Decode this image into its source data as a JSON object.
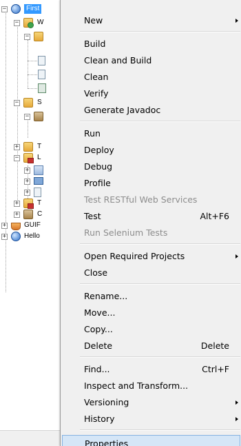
{
  "tree": {
    "selected_project": "First",
    "nodes": [
      {
        "label": "W"
      },
      {
        "label": ""
      },
      {
        "label": "S"
      },
      {
        "label": ""
      },
      {
        "label": "T"
      },
      {
        "label": "L"
      },
      {
        "label": "T"
      },
      {
        "label": "C"
      }
    ],
    "projects": [
      {
        "label": "GUIF"
      },
      {
        "label": "Hello"
      }
    ]
  },
  "context_menu": {
    "groups": [
      [
        {
          "label": "New",
          "submenu": true
        }
      ],
      [
        {
          "label": "Build"
        },
        {
          "label": "Clean and Build"
        },
        {
          "label": "Clean"
        },
        {
          "label": "Verify"
        },
        {
          "label": "Generate Javadoc"
        }
      ],
      [
        {
          "label": "Run"
        },
        {
          "label": "Deploy"
        },
        {
          "label": "Debug"
        },
        {
          "label": "Profile"
        },
        {
          "label": "Test RESTful Web Services",
          "disabled": true
        },
        {
          "label": "Test",
          "shortcut": "Alt+F6"
        },
        {
          "label": "Run Selenium Tests",
          "disabled": true
        }
      ],
      [
        {
          "label": "Open Required Projects",
          "submenu": true
        },
        {
          "label": "Close"
        }
      ],
      [
        {
          "label": "Rename..."
        },
        {
          "label": "Move..."
        },
        {
          "label": "Copy..."
        },
        {
          "label": "Delete",
          "shortcut": "Delete"
        }
      ],
      [
        {
          "label": "Find...",
          "shortcut": "Ctrl+F"
        },
        {
          "label": "Inspect and Transform..."
        },
        {
          "label": "Versioning",
          "submenu": true
        },
        {
          "label": "History",
          "submenu": true
        }
      ],
      [
        {
          "label": "Properties",
          "highlighted": true
        }
      ]
    ]
  },
  "colors": {
    "selection": "#3399ff",
    "menu_background": "#f0f0f0",
    "menu_highlight": "#d5e6f7",
    "menu_highlight_border": "#84b2e1",
    "disabled_text": "#8d8d8d"
  }
}
